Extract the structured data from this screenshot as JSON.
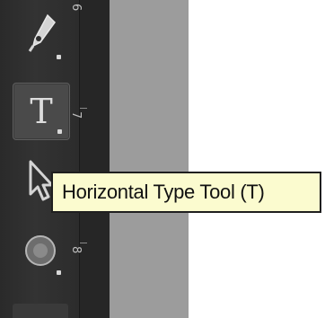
{
  "toolbar": {
    "tools": [
      {
        "name": "pen-tool",
        "icon": "pen-icon",
        "active": false
      },
      {
        "name": "horizontal-type-tool",
        "icon": "type-icon",
        "glyph": "T",
        "active": true
      },
      {
        "name": "path-selection-tool",
        "icon": "arrow-cursor-icon",
        "active": false
      },
      {
        "name": "shape-tool",
        "icon": "shape-icon",
        "active": false
      }
    ]
  },
  "ruler": {
    "labels": [
      "6",
      "7",
      "8"
    ]
  },
  "tooltip": {
    "text": "Horizontal Type Tool (T)"
  },
  "colors": {
    "toolbar_bg": "#2f2f2f",
    "ruler_bg": "#262626",
    "pasteboard": "#9c9c9c",
    "canvas": "#ffffff",
    "tooltip_bg": "#fbfbcf"
  }
}
